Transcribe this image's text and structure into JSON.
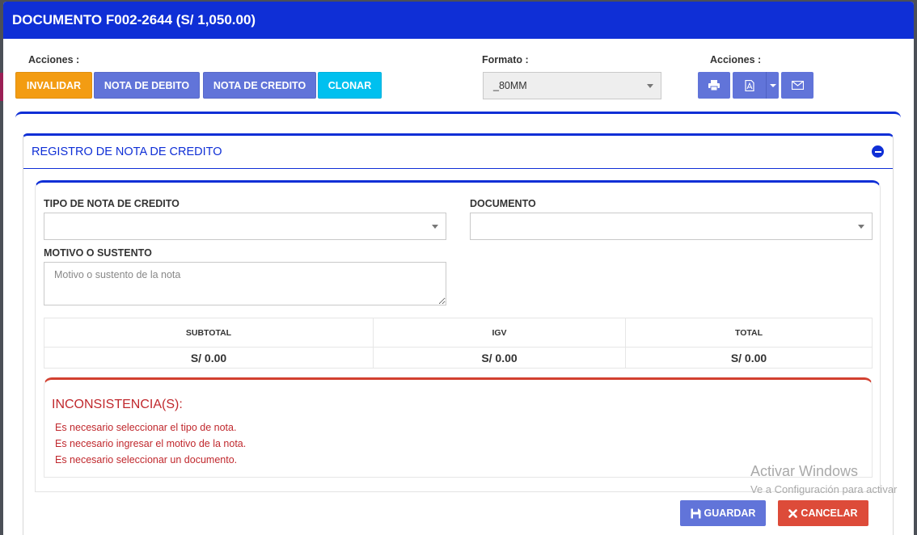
{
  "header": {
    "title": "DOCUMENTO F002-2644 (S/ 1,050.00)"
  },
  "toolbar": {
    "acciones_label": "Acciones :",
    "buttons": {
      "invalidar": "INVALIDAR",
      "nota_debito": "NOTA DE DEBITO",
      "nota_credito": "NOTA DE CREDITO",
      "clonar": "CLONAR"
    },
    "formato_label": "Formato :",
    "formato_value": "_80MM",
    "acciones_right_label": "Acciones :",
    "icons": [
      "print-icon",
      "pdf-icon",
      "caret-down-icon",
      "mail-icon"
    ]
  },
  "panel": {
    "title": "REGISTRO DE NOTA DE CREDITO",
    "tipo_label": "TIPO DE NOTA DE CREDITO",
    "tipo_value": "",
    "documento_label": "DOCUMENTO",
    "documento_value": "",
    "motivo_label": "MOTIVO O SUSTENTO",
    "motivo_placeholder": "Motivo o sustento de la nota",
    "totals": {
      "headers": [
        "SUBTOTAL",
        "IGV",
        "TOTAL"
      ],
      "values": [
        "S/ 0.00",
        "S/ 0.00",
        "S/ 0.00"
      ]
    },
    "errors": {
      "title": "INCONSISTENCIA(S):",
      "items": [
        "Es necesario seleccionar el tipo de nota.",
        "Es necesario ingresar el motivo de la nota.",
        "Es necesario seleccionar un documento."
      ]
    }
  },
  "footer": {
    "guardar": "GUARDAR",
    "cancelar": "CANCELAR"
  },
  "watermark": {
    "line1": "Activar Windows",
    "line2": "Ve a Configuración para activar"
  },
  "colors": {
    "primary": "#0f2fd6",
    "orange": "#f39c12",
    "indigo": "#6174d9",
    "cyan": "#00c0ef",
    "danger": "#dd4b39",
    "error_text": "#c0282d"
  }
}
